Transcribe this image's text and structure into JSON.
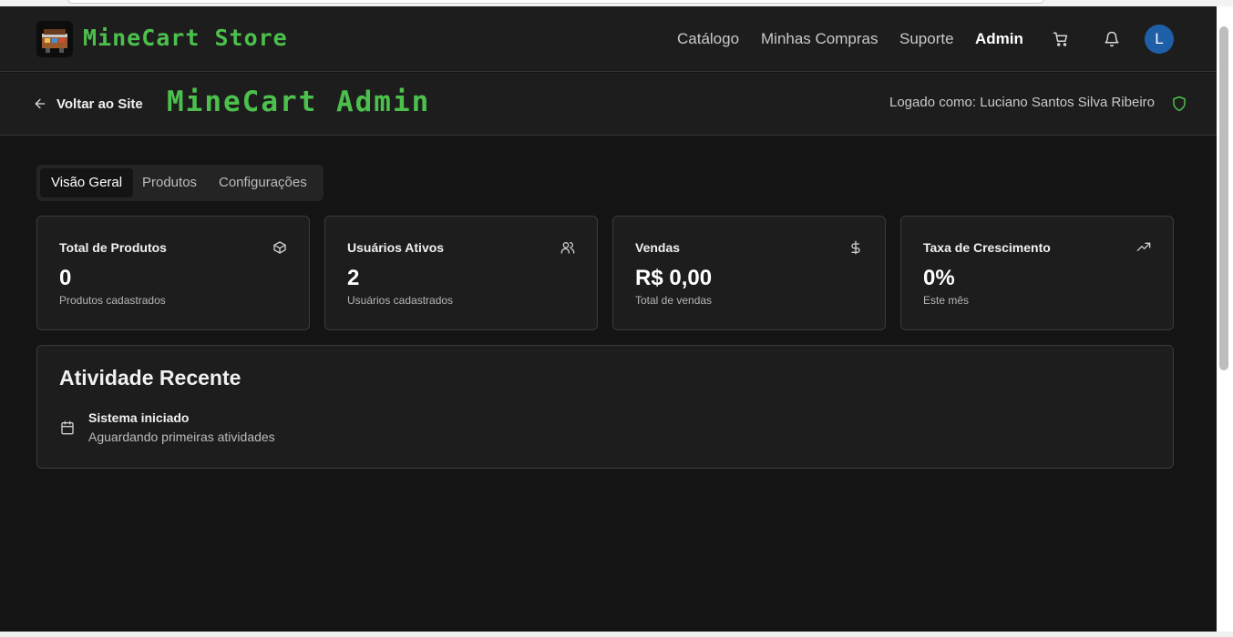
{
  "header": {
    "brand": "MineCart Store",
    "nav": [
      "Catálogo",
      "Minhas Compras",
      "Suporte",
      "Admin"
    ],
    "active_nav": "Admin",
    "avatar_initial": "L",
    "icons": [
      "cart-icon",
      "bell-icon"
    ]
  },
  "admin_bar": {
    "back_label": "Voltar ao Site",
    "title": "MineCart Admin",
    "logged_in": "Logado como: Luciano Santos Silva Ribeiro"
  },
  "tabs": {
    "items": [
      "Visão Geral",
      "Produtos",
      "Configurações"
    ],
    "active": "Visão Geral"
  },
  "stats": [
    {
      "title": "Total de Produtos",
      "value": "0",
      "subtitle": "Produtos cadastrados",
      "icon": "package-icon"
    },
    {
      "title": "Usuários Ativos",
      "value": "2",
      "subtitle": "Usuários cadastrados",
      "icon": "users-icon"
    },
    {
      "title": "Vendas",
      "value": "R$ 0,00",
      "subtitle": "Total de vendas",
      "icon": "dollar-icon"
    },
    {
      "title": "Taxa de Crescimento",
      "value": "0%",
      "subtitle": "Este mês",
      "icon": "trending-up-icon"
    }
  ],
  "activity": {
    "title": "Atividade Recente",
    "items": [
      {
        "title": "Sistema iniciado",
        "description": "Aguardando primeiras atividades",
        "icon": "calendar-icon"
      }
    ]
  },
  "colors": {
    "accent_green": "#4cc04c",
    "background": "#141414",
    "surface": "#1d1d1d",
    "avatar_blue": "#1f5fa8"
  }
}
